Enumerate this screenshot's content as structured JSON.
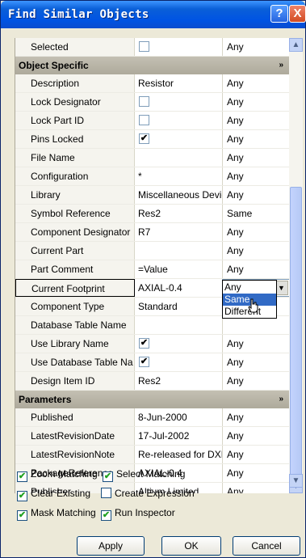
{
  "window": {
    "title": "Find Similar Objects",
    "help_label": "?",
    "close_label": "X"
  },
  "rows_top": [
    {
      "label": "Selected",
      "value": "",
      "checkbox": true,
      "checked": false,
      "match": "Any"
    }
  ],
  "section_object": {
    "title": "Object Specific",
    "chevron": "»"
  },
  "rows_object": [
    {
      "label": "Description",
      "value": "Resistor",
      "checkbox": false,
      "match": "Any"
    },
    {
      "label": "Lock Designator",
      "value": "",
      "checkbox": true,
      "checked": false,
      "match": "Any"
    },
    {
      "label": "Lock Part ID",
      "value": "",
      "checkbox": true,
      "checked": false,
      "match": "Any"
    },
    {
      "label": "Pins Locked",
      "value": "",
      "checkbox": true,
      "checked": true,
      "match": "Any"
    },
    {
      "label": "File Name",
      "value": "",
      "checkbox": false,
      "match": "Any"
    },
    {
      "label": "Configuration",
      "value": "*",
      "checkbox": false,
      "match": "Any"
    },
    {
      "label": "Library",
      "value": "Miscellaneous Devic",
      "checkbox": false,
      "match": "Any"
    },
    {
      "label": "Symbol Reference",
      "value": "Res2",
      "checkbox": false,
      "match": "Same"
    },
    {
      "label": "Component Designator",
      "value": "R7",
      "checkbox": false,
      "match": "Any"
    },
    {
      "label": "Current Part",
      "value": "",
      "checkbox": false,
      "match": "Any"
    },
    {
      "label": "Part Comment",
      "value": "=Value",
      "checkbox": false,
      "match": "Any"
    },
    {
      "label": "Current Footprint",
      "value": "AXIAL-0.4",
      "checkbox": false,
      "match": "Any",
      "selected": true
    },
    {
      "label": "Component Type",
      "value": "Standard",
      "checkbox": false,
      "match": ""
    },
    {
      "label": "Database Table Name",
      "value": "",
      "checkbox": false,
      "match": ""
    },
    {
      "label": "Use Library Name",
      "value": "",
      "checkbox": true,
      "checked": true,
      "match": "Any"
    },
    {
      "label": "Use Database Table Na",
      "value": "",
      "checkbox": true,
      "checked": true,
      "match": "Any"
    },
    {
      "label": "Design Item ID",
      "value": "Res2",
      "checkbox": false,
      "match": "Any"
    }
  ],
  "section_params": {
    "title": "Parameters",
    "chevron": "»"
  },
  "rows_params": [
    {
      "label": "Published",
      "value": "8-Jun-2000",
      "checkbox": false,
      "match": "Any"
    },
    {
      "label": "LatestRevisionDate",
      "value": "17-Jul-2002",
      "checkbox": false,
      "match": "Any"
    },
    {
      "label": "LatestRevisionNote",
      "value": "Re-released for DXF",
      "checkbox": false,
      "match": "Any"
    },
    {
      "label": "PackageReference",
      "value": "AXIAL-0.4",
      "checkbox": false,
      "match": "Any"
    },
    {
      "label": "Publisher",
      "value": "Altium Limited",
      "checkbox": false,
      "match": "Any"
    }
  ],
  "dropdown": {
    "options": [
      "Any",
      "Same",
      "Different"
    ],
    "highlighted_index": 1
  },
  "options": {
    "zoom_matching": {
      "label": "Zoom Matching",
      "checked": true
    },
    "select_matching": {
      "label": "Select Matching",
      "checked": true
    },
    "clear_existing": {
      "label": "Clear Existing",
      "checked": true
    },
    "create_expression": {
      "label": "Create Expression",
      "checked": false
    },
    "mask_matching": {
      "label": "Mask Matching",
      "checked": true
    },
    "run_inspector": {
      "label": "Run Inspector",
      "checked": true
    }
  },
  "buttons": {
    "apply": "Apply",
    "ok": "OK",
    "cancel": "Cancel"
  },
  "colors": {
    "title_bar": "#0054e3",
    "selection": "#316ac5",
    "section_header": "#b8b4a6",
    "dialog_bg": "#ece9d8"
  }
}
